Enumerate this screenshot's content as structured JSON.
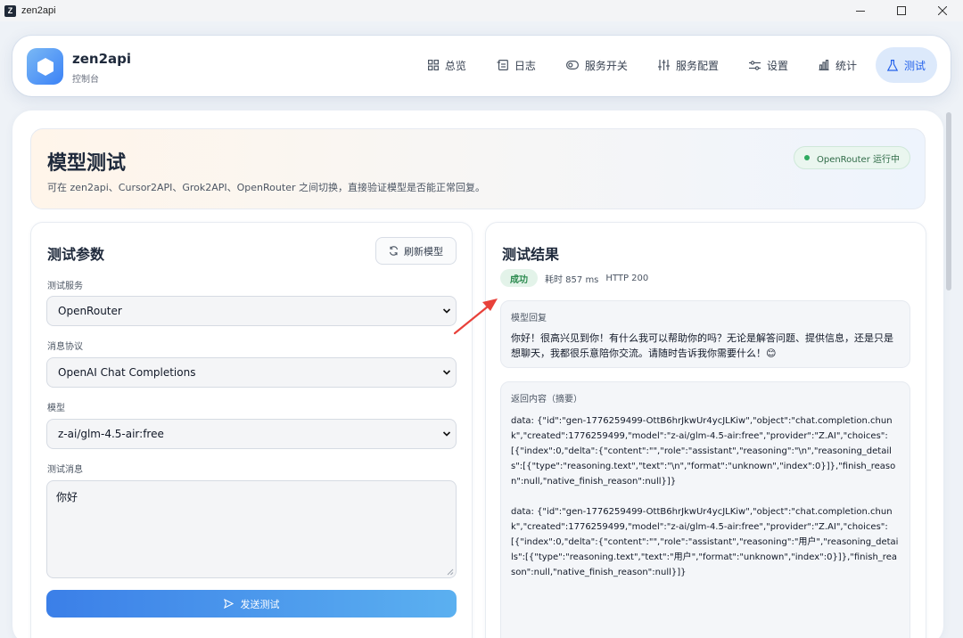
{
  "window": {
    "title": "zen2api",
    "icon_letter": "Z"
  },
  "brand": {
    "name": "zen2api",
    "subtitle": "控制台"
  },
  "nav": {
    "items": [
      {
        "label": "总览",
        "icon": "grid-icon"
      },
      {
        "label": "日志",
        "icon": "log-icon"
      },
      {
        "label": "服务开关",
        "icon": "toggle-icon"
      },
      {
        "label": "服务配置",
        "icon": "sliders-icon"
      },
      {
        "label": "设置",
        "icon": "settings-icon"
      },
      {
        "label": "统计",
        "icon": "bar-chart-icon"
      },
      {
        "label": "测试",
        "icon": "flask-icon",
        "active": true
      }
    ]
  },
  "hero": {
    "title": "模型测试",
    "description": "可在 zen2api、Cursor2API、Grok2API、OpenRouter 之间切换，直接验证模型是否能正常回复。",
    "status": "OpenRouter 运行中"
  },
  "params": {
    "title": "测试参数",
    "refresh_label": "刷新模型",
    "service_label": "测试服务",
    "service_value": "OpenRouter",
    "protocol_label": "消息协议",
    "protocol_value": "OpenAI Chat Completions",
    "model_label": "模型",
    "model_value": "z-ai/glm-4.5-air:free",
    "message_label": "测试消息",
    "message_value": "你好",
    "send_label": "发送测试"
  },
  "result": {
    "title": "测试结果",
    "status_badge": "成功",
    "elapsed": "耗时 857 ms",
    "http_status": "HTTP 200",
    "reply_label": "模型回复",
    "reply_text": "你好！很高兴见到你！有什么我可以帮助你的吗？无论是解答问题、提供信息，还是只是想聊天，我都很乐意陪你交流。请随时告诉我你需要什么！😊",
    "raw_label": "返回内容（摘要）",
    "raw_text": "data: {\"id\":\"gen-1776259499-OttB6hrJkwUr4ycJLKiw\",\"object\":\"chat.completion.chunk\",\"created\":1776259499,\"model\":\"z-ai/glm-4.5-air:free\",\"provider\":\"Z.AI\",\"choices\":[{\"index\":0,\"delta\":{\"content\":\"\",\"role\":\"assistant\",\"reasoning\":\"\\n\",\"reasoning_details\":[{\"type\":\"reasoning.text\",\"text\":\"\\n\",\"format\":\"unknown\",\"index\":0}]},\"finish_reason\":null,\"native_finish_reason\":null}]}\n\ndata: {\"id\":\"gen-1776259499-OttB6hrJkwUr4ycJLKiw\",\"object\":\"chat.completion.chunk\",\"created\":1776259499,\"model\":\"z-ai/glm-4.5-air:free\",\"provider\":\"Z.AI\",\"choices\":[{\"index\":0,\"delta\":{\"content\":\"\",\"role\":\"assistant\",\"reasoning\":\"用户\",\"reasoning_details\":[{\"type\":\"reasoning.text\",\"text\":\"用户\",\"format\":\"unknown\",\"index\":0}]},\"finish_reason\":null,\"native_finish_reason\":null}]}"
  },
  "colors": {
    "accent": "#2563eb",
    "active_nav_bg": "#dce9fb",
    "success": "#2b8a4e",
    "annotation_arrow": "#e8413a"
  }
}
